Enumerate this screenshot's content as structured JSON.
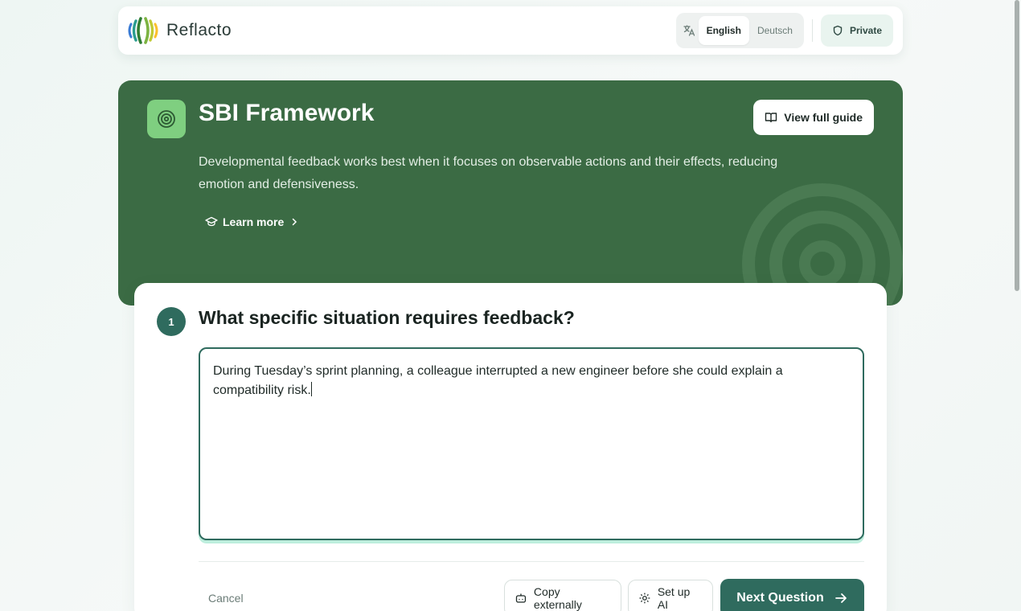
{
  "app": {
    "name": "Reflacto"
  },
  "header": {
    "languages": [
      {
        "label": "English",
        "active": true
      },
      {
        "label": "Deutsch",
        "active": false
      }
    ],
    "privacy_label": "Private"
  },
  "hero": {
    "title": "SBI Framework",
    "description": "Developmental feedback works best when it focuses on observable actions and their effects, reducing emotion and defensiveness.",
    "learn_more": "Learn more",
    "guide_button": "View full guide",
    "accent_color": "#3b6b44"
  },
  "question_card": {
    "step_number": "1",
    "question": "What specific situation requires feedback?",
    "answer": "During Tuesday’s sprint planning, a colleague interrupted a new engineer before she could explain a compatibility risk.",
    "cancel_label": "Cancel",
    "copy_label": "Copy externally",
    "ai_label": "Set up AI",
    "next_label": "Next Question",
    "accent_color": "#2f6b5e"
  }
}
